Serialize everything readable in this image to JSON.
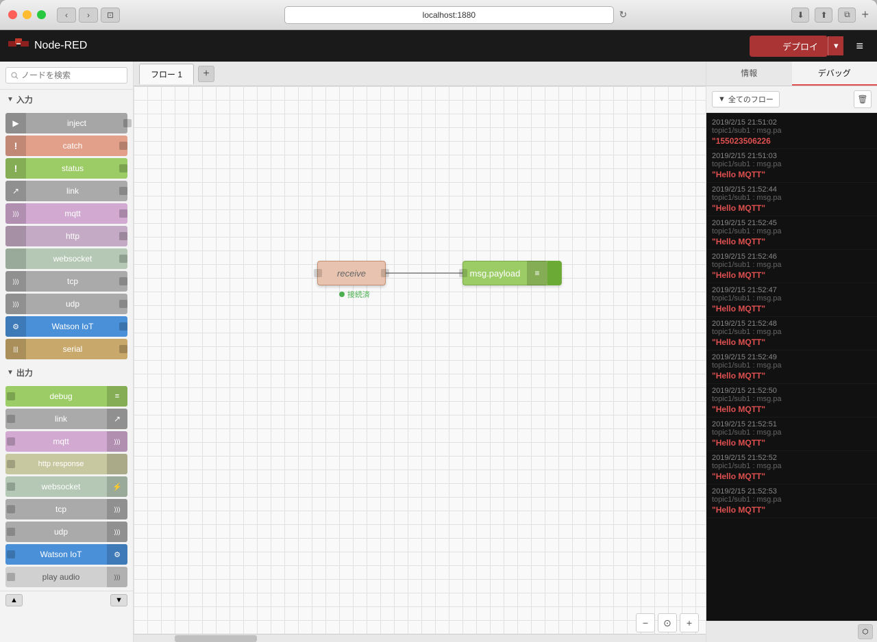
{
  "window": {
    "title": "Node-RED",
    "url": "localhost:1880"
  },
  "header": {
    "title": "Node-RED",
    "deploy_label": "デプロイ",
    "menu_icon": "≡"
  },
  "search": {
    "placeholder": "ノードを検索"
  },
  "sidebar": {
    "section_input": "入力",
    "section_output": "出力",
    "input_nodes": [
      {
        "label": "inject",
        "color": "#a6a6a6",
        "icon": "▶"
      },
      {
        "label": "catch",
        "color": "#e2a08a",
        "icon": "!"
      },
      {
        "label": "status",
        "color": "#9ccc65",
        "icon": "!"
      },
      {
        "label": "link",
        "color": "#aaaaaa",
        "icon": "↗"
      },
      {
        "label": "mqtt",
        "color": "#d1a9d1",
        "icon": ")))"
      },
      {
        "label": "http",
        "color": "#b9b9cc",
        "icon": ""
      },
      {
        "label": "websocket",
        "color": "#b9c9b0",
        "icon": ""
      },
      {
        "label": "tcp",
        "color": "#aaaaaa",
        "icon": ")))"
      },
      {
        "label": "udp",
        "color": "#aaaaaa",
        "icon": ")))"
      },
      {
        "label": "Watson IoT",
        "color": "#4a90d9",
        "icon": "⚙"
      },
      {
        "label": "serial",
        "color": "#c8a86b",
        "icon": "|||"
      }
    ],
    "output_nodes": [
      {
        "label": "debug",
        "color": "#9ccc65",
        "icon": "≡"
      },
      {
        "label": "link",
        "color": "#aaaaaa",
        "icon": "↗"
      },
      {
        "label": "mqtt",
        "color": "#d1a9d1",
        "icon": ")))"
      },
      {
        "label": "http response",
        "color": "#c8c8a0",
        "icon": ""
      },
      {
        "label": "websocket",
        "color": "#b9c9b0",
        "icon": ""
      },
      {
        "label": "tcp",
        "color": "#aaaaaa",
        "icon": ")))"
      },
      {
        "label": "udp",
        "color": "#aaaaaa",
        "icon": ")))"
      },
      {
        "label": "Watson IoT",
        "color": "#4a90d9",
        "icon": "⚙"
      },
      {
        "label": "play audio",
        "color": "#d9d9d9",
        "icon": ")))"
      }
    ]
  },
  "canvas": {
    "tab_label": "フロー 1",
    "add_tab": "+",
    "nodes": {
      "receive": {
        "label": "receive",
        "status": "接続済"
      },
      "msg_payload": {
        "label": "msg.payload"
      }
    }
  },
  "right_panel": {
    "tab_info": "情報",
    "tab_debug": "デバッグ",
    "filter_label": "全てのフロー",
    "debug_entries": [
      {
        "time": "2019/2/15 21:51:02",
        "topic": "topic1/sub1 : msg.pa",
        "value": "\"155023506226"
      },
      {
        "time": "2019/2/15 21:51:03",
        "topic": "topic1/sub1 : msg.pa",
        "value": "\"Hello MQTT\""
      },
      {
        "time": "2019/2/15 21:52:44",
        "topic": "topic1/sub1 : msg.pa",
        "value": "\"Hello MQTT\""
      },
      {
        "time": "2019/2/15 21:52:45",
        "topic": "topic1/sub1 : msg.pa",
        "value": "\"Hello MQTT\""
      },
      {
        "time": "2019/2/15 21:52:46",
        "topic": "topic1/sub1 : msg.pa",
        "value": "\"Hello MQTT\""
      },
      {
        "time": "2019/2/15 21:52:47",
        "topic": "topic1/sub1 : msg.pa",
        "value": "\"Hello MQTT\""
      },
      {
        "time": "2019/2/15 21:52:48",
        "topic": "topic1/sub1 : msg.pa",
        "value": "\"Hello MQTT\""
      },
      {
        "time": "2019/2/15 21:52:49",
        "topic": "topic1/sub1 : msg.pa",
        "value": "\"Hello MQTT\""
      },
      {
        "time": "2019/2/15 21:52:50",
        "topic": "topic1/sub1 : msg.pa",
        "value": "\"Hello MQTT\""
      },
      {
        "time": "2019/2/15 21:52:51",
        "topic": "topic1/sub1 : msg.pa",
        "value": "\"Hello MQTT\""
      },
      {
        "time": "2019/2/15 21:52:52",
        "topic": "topic1/sub1 : msg.pa",
        "value": "\"Hello MQTT\""
      },
      {
        "time": "2019/2/15 21:52:53",
        "topic": "topic1/sub1 : msg.pa",
        "value": "\"Hello MQTT\""
      }
    ]
  }
}
